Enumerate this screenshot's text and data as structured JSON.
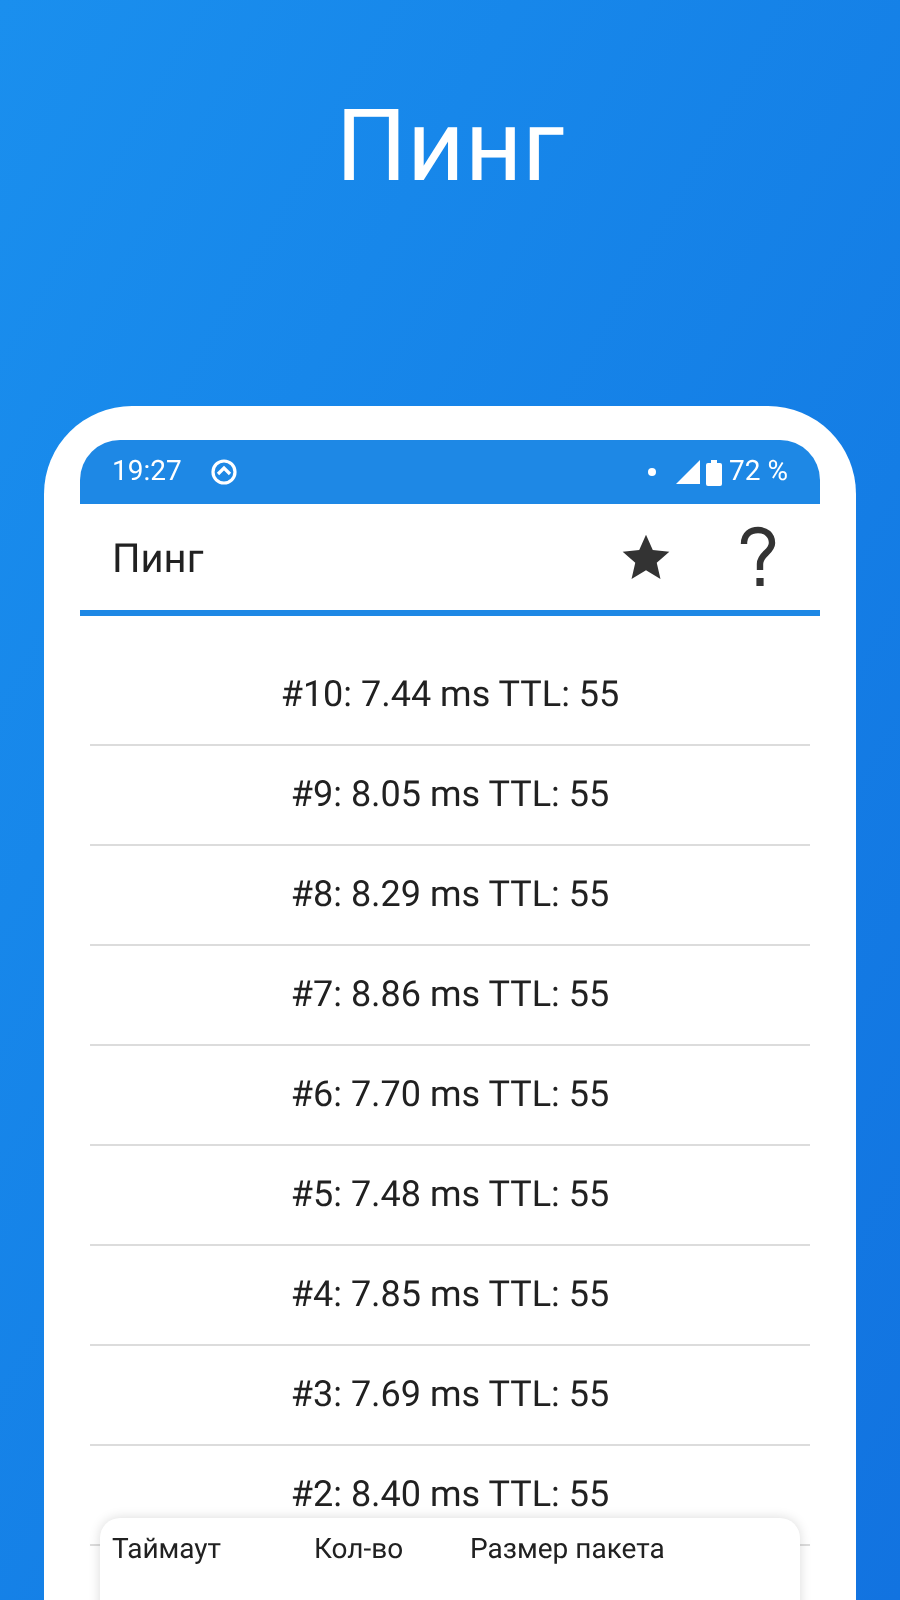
{
  "headline": "Пинг",
  "status_bar": {
    "time": "19:27",
    "battery": "72 %"
  },
  "app_bar": {
    "title": "Пинг"
  },
  "results": [
    "#10: 7.44 ms TTL: 55",
    "#9: 8.05 ms TTL: 55",
    "#8: 8.29 ms TTL: 55",
    "#7: 8.86 ms TTL: 55",
    "#6: 7.70 ms TTL: 55",
    "#5: 7.48 ms TTL: 55",
    "#4: 7.85 ms TTL: 55",
    "#3: 7.69 ms TTL: 55",
    "#2: 8.40 ms TTL: 55"
  ],
  "settings_panel": {
    "labels": [
      "Таймаут",
      "Кол-во",
      "Размер пакета"
    ]
  }
}
